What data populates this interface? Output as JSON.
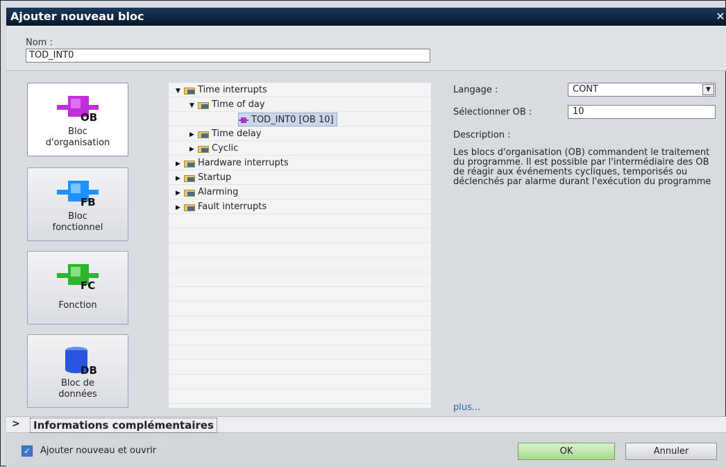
{
  "dialog": {
    "title": "Ajouter nouveau bloc",
    "close_glyph": "✕"
  },
  "name_field": {
    "label": "Nom :",
    "value": "TOD_INT0"
  },
  "block_types": [
    {
      "icon": "ob-icon",
      "icon_text": "OB",
      "label": "Bloc\nd'organisation",
      "color": "#c030d8",
      "selected": true
    },
    {
      "icon": "fb-icon",
      "icon_text": "FB",
      "label": "Bloc\nfonctionnel",
      "color": "#1e90ff",
      "selected": false
    },
    {
      "icon": "fc-icon",
      "icon_text": "FC",
      "label": "Fonction",
      "color": "#2db52d",
      "selected": false
    },
    {
      "icon": "db-icon",
      "icon_text": "DB",
      "label": "Bloc de\ndonnées",
      "color": "#2a55e0",
      "selected": false
    }
  ],
  "tree": {
    "items": [
      {
        "label": "Time interrupts",
        "expanded": true
      },
      {
        "label": "Time of day",
        "expanded": true
      },
      {
        "label": "TOD_INT0 [OB 10]",
        "selected": true
      },
      {
        "label": "Time delay",
        "expanded": false
      },
      {
        "label": "Cyclic",
        "expanded": false
      },
      {
        "label": "Hardware interrupts",
        "expanded": false
      },
      {
        "label": "Startup",
        "expanded": false
      },
      {
        "label": "Alarming",
        "expanded": false
      },
      {
        "label": "Fault interrupts",
        "expanded": false
      }
    ]
  },
  "properties": {
    "language_label": "Langage :",
    "language_value": "CONT",
    "ob_label": "Sélectionner OB :",
    "ob_value": "10",
    "description_label": "Description :",
    "description_text": "Les blocs d'organisation (OB) commandent le traitement du programme. Il est possible par l'intermédiaire des OB de réagir aux événements cycliques, temporisés ou déclenchés par alarme durant l'exécution du programme",
    "more_link": "plus..."
  },
  "info_section": {
    "chevron": ">",
    "label": "Informations complémentaires"
  },
  "footer": {
    "checkbox_label": "Ajouter nouveau et ouvrir",
    "checkbox_checked": true,
    "ok_label": "OK",
    "cancel_label": "Annuler"
  }
}
